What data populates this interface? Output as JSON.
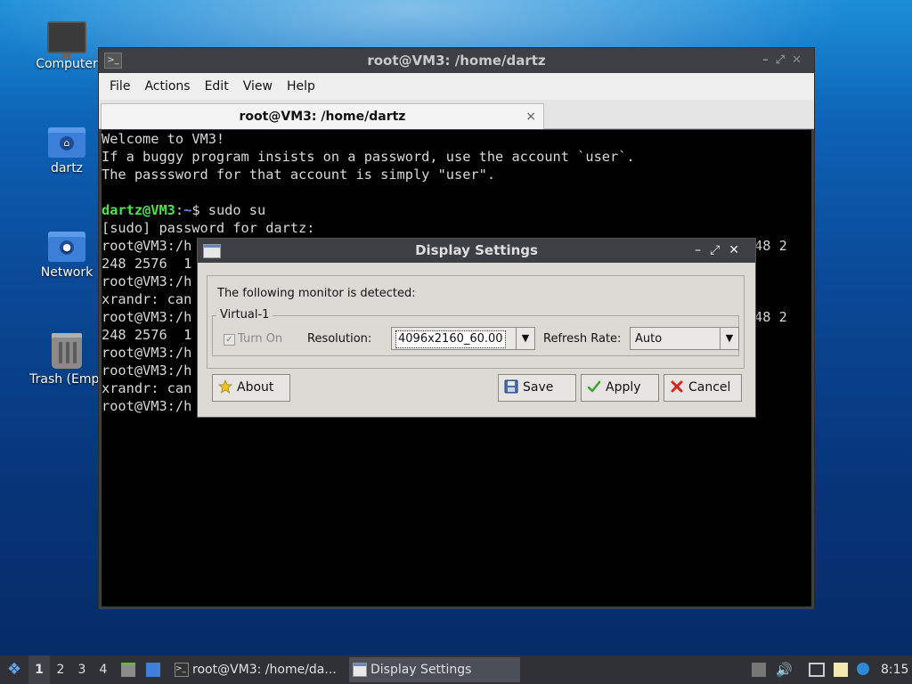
{
  "desktop": {
    "icons": [
      {
        "label": "Computer"
      },
      {
        "label": "dartz"
      },
      {
        "label": "Network"
      },
      {
        "label": "Trash (Empt"
      }
    ]
  },
  "terminal": {
    "title": "root@VM3: /home/dartz",
    "menu": [
      "File",
      "Actions",
      "Edit",
      "View",
      "Help"
    ],
    "tab_label": "root@VM3: /home/dartz",
    "tab_close": "×",
    "lines": {
      "l1": "Welcome to VM3!",
      "l2": "If a buggy program insists on a password, use the account `user`.",
      "l3": "The passsword for that account is simply \"user\".",
      "l4": "",
      "l5_user": "dartz@VM3",
      "l5_colon": ":",
      "l5_path": "~",
      "l5_cmd": "$ sudo su",
      "l6": "[sudo] password for dartz:",
      "l7": "root@VM3:/h",
      "l7_tail": "48 2",
      "l8": "248 2576  1",
      "l9": "root@VM3:/h",
      "l10": "xrandr: can",
      "l11": "root@VM3:/h",
      "l11_tail": "48 2",
      "l12": "248 2576  1",
      "l13": "root@VM3:/h",
      "l14": "root@VM3:/h",
      "l15": "xrandr: can",
      "l16": "root@VM3:/h"
    }
  },
  "dialog": {
    "title": "Display Settings",
    "detected_text": "The following monitor is detected:",
    "monitor_name": "Virtual-1",
    "turn_on_label": "Turn On",
    "turn_on_checked": true,
    "resolution_label": "Resolution:",
    "resolution_value": "4096x2160_60.00",
    "refresh_label": "Refresh Rate:",
    "refresh_value": "Auto",
    "buttons": {
      "about": "About",
      "save": "Save",
      "apply": "Apply",
      "cancel": "Cancel"
    }
  },
  "taskbar": {
    "workspaces": [
      "1",
      "2",
      "3",
      "4"
    ],
    "active_workspace": "1",
    "tasks": [
      {
        "label": "root@VM3: /home/da..."
      },
      {
        "label": "Display Settings"
      }
    ],
    "clock": "8:15"
  },
  "colors": {
    "prompt_user": "#4ee34e",
    "prompt_path": "#6b8cff",
    "titlebar": "#3c3f44",
    "dialog_bg": "#dcdad5"
  }
}
